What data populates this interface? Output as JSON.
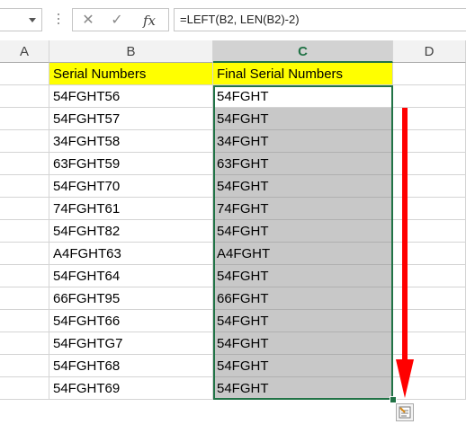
{
  "formula_bar": {
    "name_box_value": "",
    "cancel_glyph": "✕",
    "enter_glyph": "✓",
    "fx_glyph": "fx",
    "formula": "=LEFT(B2, LEN(B2)-2)"
  },
  "columns": [
    {
      "label": "A",
      "selected": false
    },
    {
      "label": "B",
      "selected": false
    },
    {
      "label": "C",
      "selected": true
    },
    {
      "label": "D",
      "selected": false
    }
  ],
  "table": {
    "header_b": "Serial Numbers",
    "header_c": "Final Serial Numbers",
    "rows": [
      {
        "b": "54FGHT56",
        "c": "54FGHT"
      },
      {
        "b": "54FGHT57",
        "c": "54FGHT"
      },
      {
        "b": "34FGHT58",
        "c": "34FGHT"
      },
      {
        "b": "63FGHT59",
        "c": "63FGHT"
      },
      {
        "b": "54FGHT70",
        "c": "54FGHT"
      },
      {
        "b": "74FGHT61",
        "c": "74FGHT"
      },
      {
        "b": "54FGHT82",
        "c": "54FGHT"
      },
      {
        "b": "A4FGHT63",
        "c": "A4FGHT"
      },
      {
        "b": "54FGHT64",
        "c": "54FGHT"
      },
      {
        "b": "66FGHT95",
        "c": "66FGHT"
      },
      {
        "b": "54FGHT66",
        "c": "54FGHT"
      },
      {
        "b": "54FGHTG7",
        "c": "54FGHT"
      },
      {
        "b": "54FGHT68",
        "c": "54FGHT"
      },
      {
        "b": "54FGHT69",
        "c": "54FGHT"
      }
    ]
  },
  "colors": {
    "header_fill": "#ffff00",
    "selection_border": "#217346",
    "shaded_fill": "#c8c8c8",
    "arrow": "#ff0000"
  },
  "icons": {
    "quick_analysis": "quick-analysis-icon",
    "fill_arrow": "down-arrow-annotation"
  }
}
